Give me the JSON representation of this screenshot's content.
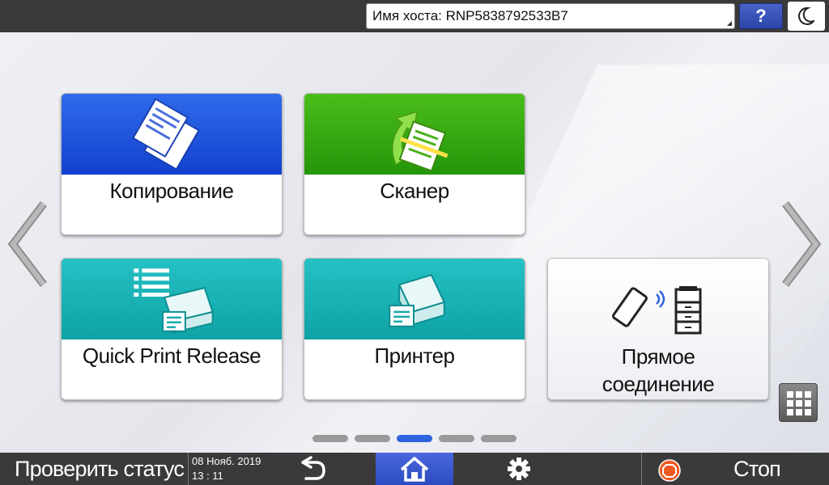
{
  "header": {
    "hostname": "Имя хоста: RNP5838792533B7",
    "help_label": "?"
  },
  "tiles": {
    "copy": "Копирование",
    "scanner": "Сканер",
    "quick_print_release": "Quick Print Release",
    "printer": "Принтер",
    "direct_connection_line1": "Прямое",
    "direct_connection_line2": "соединение"
  },
  "pager": {
    "count": 5,
    "active_index": 2
  },
  "footer": {
    "status_label": "Проверить статус",
    "date": "08 Нояб. 2019",
    "time": "13 : 11",
    "stop_label": "Стоп"
  },
  "colors": {
    "bar": "#3a3a3a",
    "accent_blue": "#2f64e0",
    "copy_blue": "#1f55e0",
    "scanner_green": "#34a812",
    "printer_teal": "#18b1b4",
    "stop_orange": "#f05a22"
  },
  "icons": {
    "energy": "moon-icon",
    "back": "back-arrow-icon",
    "home": "home-icon",
    "settings": "gear-icon",
    "stop": "stop-icon",
    "apps": "grid-icon"
  }
}
